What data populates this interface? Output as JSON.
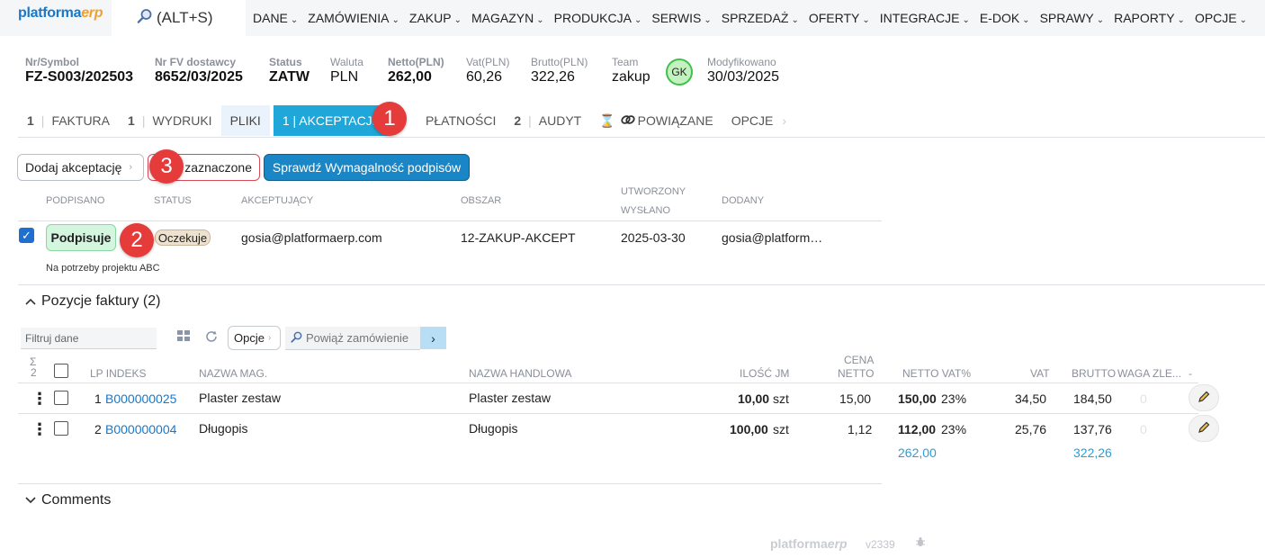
{
  "topbar": {
    "logo_main": "platforma",
    "logo_accent": "erp",
    "search_label": "(ALT+S)",
    "nav": [
      "DANE",
      "ZAMÓWIENIA",
      "ZAKUP",
      "MAGAZYN",
      "PRODUKCJA",
      "SERWIS",
      "SPRZEDAŻ",
      "OFERTY",
      "INTEGRACJE",
      "E-DOK",
      "SPRAWY",
      "RAPORTY",
      "OPCJE"
    ]
  },
  "header": {
    "nr_label": "Nr/Symbol",
    "nr_value": "FZ-S003/202503",
    "fv_label": "Nr FV dostawcy",
    "fv_value": "8652/03/2025",
    "status_label": "Status",
    "status_value": "ZATW",
    "currency_label": "Waluta",
    "currency_value": "PLN",
    "net_label": "Netto(PLN)",
    "net_value": "262,00",
    "vat_label": "Vat(PLN)",
    "vat_value": "60,26",
    "gross_label": "Brutto(PLN)",
    "gross_value": "322,26",
    "team_label": "Team",
    "team_value": "zakup",
    "avatar": "GK",
    "modified_label": "Modyfikowano",
    "modified_value": "30/03/2025"
  },
  "tabs": [
    {
      "num": "1",
      "label": "FAKTURA"
    },
    {
      "num": "1",
      "label": "WYDRUKI"
    },
    {
      "num": "",
      "label": "PLIKI"
    },
    {
      "num": "",
      "label": "1 | AKCEPTACJE"
    },
    {
      "num": "",
      "label": "PŁATNOŚCI"
    },
    {
      "num": "2",
      "label": "AUDYT"
    },
    {
      "num": "",
      "label": "POWIĄZANE"
    },
    {
      "num": "",
      "label": "OPCJE"
    }
  ],
  "markers": {
    "m1": "1",
    "m2": "2",
    "m3": "3"
  },
  "actions": {
    "add_label": "Dodaj akceptację",
    "delete_label": "zaznaczone",
    "check_label": "Sprawdź Wymagalność podpisów"
  },
  "acceptance": {
    "headers": {
      "signed": "PODPISANO",
      "status": "STATUS",
      "acceptor": "AKCEPTUJĄCY",
      "area": "OBSZAR",
      "created": "UTWORZONY",
      "sent": "WYSŁANO",
      "added": "DODANY"
    },
    "row": {
      "sign_label": "Podpisuje",
      "status": "Oczekuje",
      "acceptor": "gosia@platformaerp.com",
      "area": "12-ZAKUP-AKCEPT",
      "created": "2025-03-30",
      "added": "gosia@platform…",
      "note": "Na potrzeby projektu ABC"
    }
  },
  "positions": {
    "title": "Pozycje faktury (2)",
    "filter_placeholder": "Filtruj dane",
    "options_label": "Opcje",
    "link_order_label": "Powiąż zamówienie",
    "sigma": "Σ",
    "sigma_count": "2",
    "headers": {
      "lp_index": "LP INDEKS",
      "name_mag": "NAZWA MAG.",
      "name_trade": "NAZWA HANDLOWA",
      "qty": "ILOŚĆ JM",
      "price_1": "CENA",
      "price_2": "NETTO",
      "net_vat": "NETTO VAT%",
      "vat": "VAT",
      "gross": "BRUTTO",
      "weight": "WAGA ZLE...",
      "dash": "-"
    },
    "rows": [
      {
        "lp": "1",
        "index": "B000000025",
        "name_mag": "Plaster zestaw",
        "name_trade": "Plaster zestaw",
        "qty": "10,00",
        "unit": "szt",
        "price": "15,00",
        "net": "150,00",
        "vat_pct": "23%",
        "vat": "34,50",
        "gross": "184,50",
        "weight": "0"
      },
      {
        "lp": "2",
        "index": "B000000004",
        "name_mag": "Długopis",
        "name_trade": "Długopis",
        "qty": "100,00",
        "unit": "szt",
        "price": "1,12",
        "net": "112,00",
        "vat_pct": "23%",
        "vat": "25,76",
        "gross": "137,76",
        "weight": "0"
      }
    ],
    "sum_net": "262,00",
    "sum_gross": "322,26"
  },
  "comments": {
    "title": "Comments"
  },
  "footer": {
    "logo_main": "platforma",
    "logo_accent": "erp",
    "version": "v2339"
  }
}
